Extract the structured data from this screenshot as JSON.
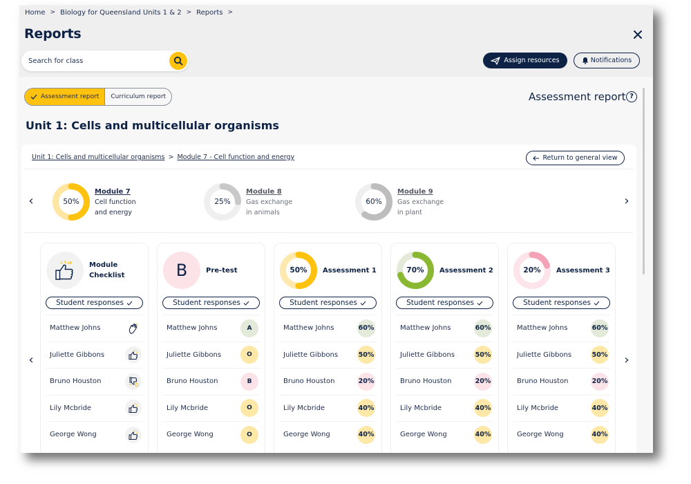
{
  "breadcrumb": [
    "Home",
    "Biology for Queensland Units 1 & 2",
    "Reports"
  ],
  "page_title": "Reports",
  "close_icon": "close-icon",
  "search": {
    "placeholder": "Search for class",
    "value": "",
    "icon": "search-icon"
  },
  "actions": {
    "assign_resources": {
      "label": "Assign resources",
      "icon": "paper-plane-icon"
    },
    "notifications": {
      "label": "Notifications",
      "icon": "bell-icon"
    }
  },
  "report_toggle": {
    "options": [
      {
        "label": "Assessment report",
        "active": true,
        "icon": "check-icon"
      },
      {
        "label": "Curriculum report",
        "active": false
      }
    ]
  },
  "report_type_label": "Assessment report",
  "help_icon": "help-icon",
  "unit_title": "Unit 1: Cells and multicellular organisms",
  "panel": {
    "breadcrumb": [
      "Unit 1: Cells and multicellular organisms",
      "Module 7 - Cell function and energy"
    ],
    "return_label": "Return to general view",
    "modules": [
      {
        "title": "Module 7",
        "line1": "Cell function",
        "line2": "and energy",
        "percent": 50,
        "percent_label": "50%",
        "active": true,
        "color": "#ffc20e",
        "track": "#ffe6a3"
      },
      {
        "title": "Module 8",
        "line1": "Gas exchange",
        "line2": "in animals",
        "percent": 25,
        "percent_label": "25%",
        "active": false,
        "color": "#c8c8c8",
        "track": "#efefef"
      },
      {
        "title": "Module 9",
        "line1": "Gas exchange",
        "line2": "in plant",
        "percent": 60,
        "percent_label": "60%",
        "active": false,
        "color": "#bdbdbd",
        "track": "#efefef"
      }
    ],
    "responses_label": "Student responses",
    "cards": [
      {
        "title_line1": "Module",
        "title_line2": "Checklist",
        "type": "checklist",
        "badge_icon": "thumbs-up-sparkle-icon",
        "students": [
          {
            "name": "Matthew Johns",
            "icon": "clapping-hands-icon"
          },
          {
            "name": "Juliette Gibbons",
            "icon": "thumbs-up-icon"
          },
          {
            "name": "Bruno Houston",
            "icon": "thumbs-down-icon"
          },
          {
            "name": "Lily Mcbride",
            "icon": "thumbs-up-icon"
          },
          {
            "name": "George Wong",
            "icon": "thumbs-up-icon"
          }
        ]
      },
      {
        "title_line1": "Pre-test",
        "title_line2": "",
        "type": "grade",
        "badge_letter": "B",
        "badge_color": "#fbe3e8",
        "students": [
          {
            "name": "Matthew Johns",
            "value": "A",
            "color": "#e4ead9"
          },
          {
            "name": "Juliette Gibbons",
            "value": "O",
            "color": "#fde8a8"
          },
          {
            "name": "Bruno Houston",
            "value": "B",
            "color": "#fbe3e8"
          },
          {
            "name": "Lily Mcbride",
            "value": "O",
            "color": "#fde8a8"
          },
          {
            "name": "George Wong",
            "value": "O",
            "color": "#fde8a8"
          }
        ]
      },
      {
        "title_line1": "Assessment 1",
        "title_line2": "",
        "type": "percent",
        "percent": 50,
        "percent_label": "50%",
        "color": "#ffc20e",
        "track": "#fde9ae",
        "students": [
          {
            "name": "Matthew Johns",
            "value": "60%",
            "color": "#e4ead9"
          },
          {
            "name": "Juliette Gibbons",
            "value": "50%",
            "color": "#fde8a8"
          },
          {
            "name": "Bruno Houston",
            "value": "20%",
            "color": "#fbe3e8"
          },
          {
            "name": "Lily Mcbride",
            "value": "40%",
            "color": "#fde8a8"
          },
          {
            "name": "George Wong",
            "value": "40%",
            "color": "#fde8a8"
          }
        ]
      },
      {
        "title_line1": "Assessment 2",
        "title_line2": "",
        "type": "percent",
        "percent": 70,
        "percent_label": "70%",
        "color": "#8ab833",
        "track": "#e4ead9",
        "students": [
          {
            "name": "Matthew Johns",
            "value": "60%",
            "color": "#e4ead9"
          },
          {
            "name": "Juliette Gibbons",
            "value": "50%",
            "color": "#fde8a8"
          },
          {
            "name": "Bruno Houston",
            "value": "20%",
            "color": "#fbe3e8"
          },
          {
            "name": "Lily Mcbride",
            "value": "40%",
            "color": "#fde8a8"
          },
          {
            "name": "George Wong",
            "value": "40%",
            "color": "#fde8a8"
          }
        ]
      },
      {
        "title_line1": "Assessment 3",
        "title_line2": "",
        "type": "percent",
        "percent": 20,
        "percent_label": "20%",
        "color": "#f3a3b5",
        "track": "#fce4ea",
        "students": [
          {
            "name": "Matthew Johns",
            "value": "60%",
            "color": "#e4ead9"
          },
          {
            "name": "Juliette Gibbons",
            "value": "50%",
            "color": "#fde8a8"
          },
          {
            "name": "Bruno Houston",
            "value": "20%",
            "color": "#fbe3e8"
          },
          {
            "name": "Lily Mcbride",
            "value": "40%",
            "color": "#fde8a8"
          },
          {
            "name": "George Wong",
            "value": "40%",
            "color": "#fde8a8"
          }
        ]
      }
    ]
  },
  "colors": {
    "navy": "#0e2246",
    "accent_yellow": "#ffc20e"
  }
}
